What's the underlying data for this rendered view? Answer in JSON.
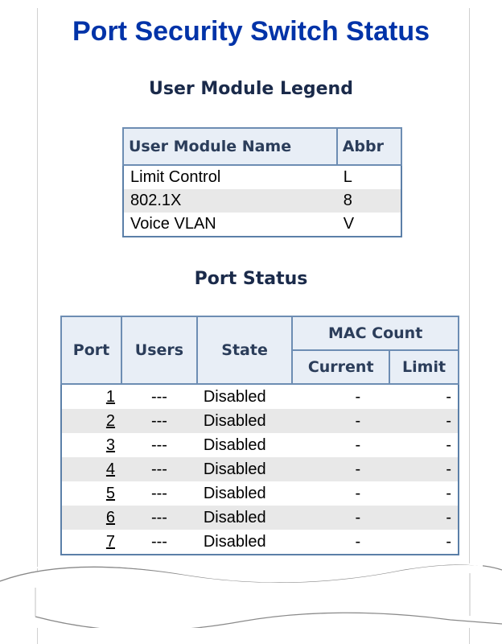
{
  "page_title": "Port Security Switch Status",
  "legend": {
    "title": "User Module Legend",
    "headers": [
      "User Module Name",
      "Abbr"
    ],
    "rows": [
      {
        "name": "Limit Control",
        "abbr": "L"
      },
      {
        "name": "802.1X",
        "abbr": "8"
      },
      {
        "name": "Voice VLAN",
        "abbr": "V"
      }
    ]
  },
  "port_status": {
    "title": "Port Status",
    "headers": {
      "port": "Port",
      "users": "Users",
      "state": "State",
      "mac_count": "MAC Count",
      "current": "Current",
      "limit": "Limit"
    },
    "rows": [
      {
        "port": "1",
        "users": "---",
        "state": "Disabled",
        "current": "-",
        "limit": "-"
      },
      {
        "port": "2",
        "users": "---",
        "state": "Disabled",
        "current": "-",
        "limit": "-"
      },
      {
        "port": "3",
        "users": "---",
        "state": "Disabled",
        "current": "-",
        "limit": "-"
      },
      {
        "port": "4",
        "users": "---",
        "state": "Disabled",
        "current": "-",
        "limit": "-"
      },
      {
        "port": "5",
        "users": "---",
        "state": "Disabled",
        "current": "-",
        "limit": "-"
      },
      {
        "port": "6",
        "users": "---",
        "state": "Disabled",
        "current": "-",
        "limit": "-"
      },
      {
        "port": "7",
        "users": "---",
        "state": "Disabled",
        "current": "-",
        "limit": "-"
      }
    ]
  },
  "colors": {
    "title": "#0033a8",
    "table_border": "#5b7fa8",
    "header_bg": "#e8eef6",
    "alt_row_bg": "#e8e8e8"
  }
}
